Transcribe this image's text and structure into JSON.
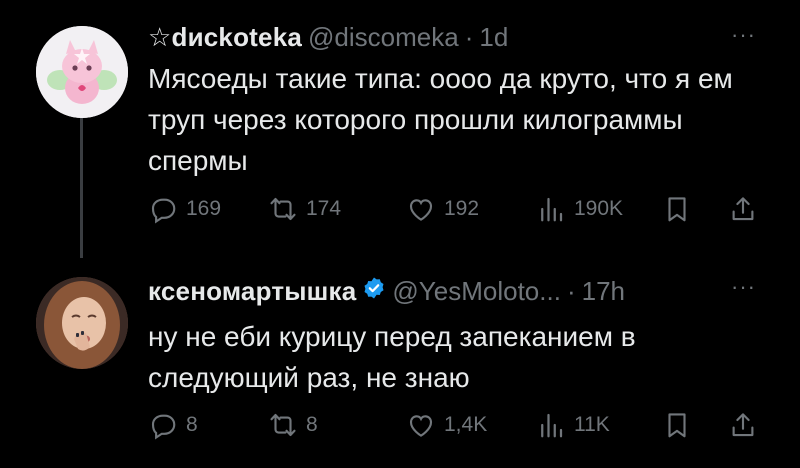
{
  "tweets": [
    {
      "name": "☆dиckotеka",
      "handle": "@discomeka",
      "separator": "·",
      "time": "1d",
      "more": "···",
      "text": "Мясоеды такие типа: оооо да круто, что я ем труп через которого прошли килограммы спермы",
      "replies": "169",
      "retweets": "174",
      "likes": "192",
      "views": "190K"
    },
    {
      "name": "ксеномартышка",
      "verified": true,
      "handle": "@YesMoloto...",
      "separator": "·",
      "time": "17h",
      "more": "···",
      "text": "ну не еби курицу перед запеканием в следующий раз, не знаю",
      "replies": "8",
      "retweets": "8",
      "likes": "1,4K",
      "views": "11K"
    }
  ],
  "colors": {
    "background": "#000000",
    "text": "#e7e9ea",
    "secondary": "#71767b",
    "verified": "#1d9bf0",
    "thread_line": "#3a3d41"
  },
  "icons": [
    "reply-icon",
    "retweet-icon",
    "like-icon",
    "views-icon",
    "bookmark-icon",
    "share-icon",
    "verified-icon"
  ]
}
